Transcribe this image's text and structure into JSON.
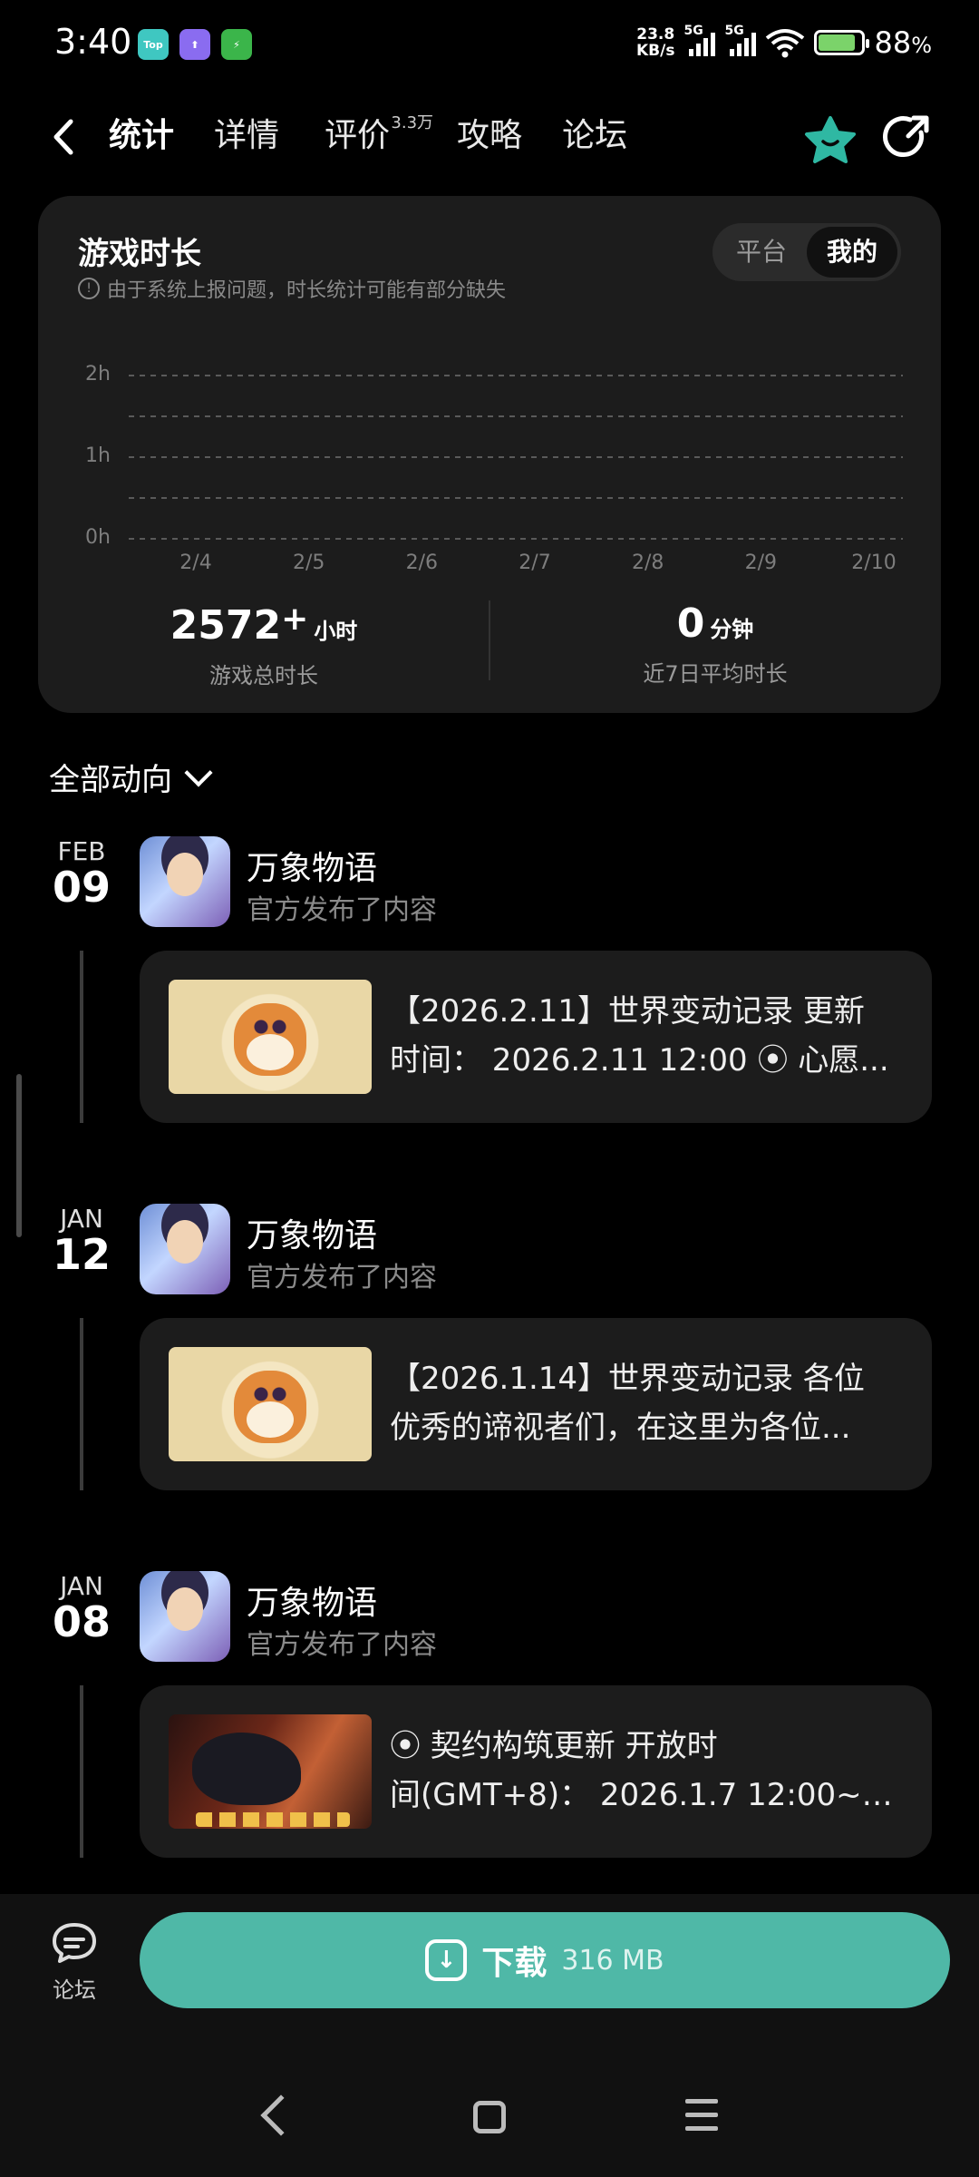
{
  "status_bar": {
    "time": "3:40",
    "apps": [
      {
        "name": "top-app-icon",
        "label": "Top",
        "color": "#3fc7c1"
      },
      {
        "name": "upload-app-icon",
        "label": "⬆",
        "color": "#8a6cf0"
      },
      {
        "name": "bolt-app-icon",
        "label": "⚡",
        "color": "#3bb54a"
      }
    ],
    "net_speed_value": "23.8",
    "net_speed_unit": "KB/s",
    "sig1_label": "5G",
    "sig2_label": "5G",
    "battery_pct": "88",
    "battery_unit": "%",
    "battery_level": 0.88
  },
  "nav": {
    "tabs": [
      {
        "label": "统计",
        "active": true
      },
      {
        "label": "详情"
      },
      {
        "label": "评价",
        "badge": "3.3万"
      },
      {
        "label": "攻略"
      },
      {
        "label": "论坛"
      }
    ],
    "icons": {
      "back": "back-arrow-icon",
      "star": "star-icon",
      "share": "share-icon"
    },
    "accent": "#2fb8a3"
  },
  "stats": {
    "title": "游戏时长",
    "note": "由于系统上报问题，时长统计可能有部分缺失",
    "toggle": {
      "left": "平台",
      "right": "我的",
      "selected": "我的"
    },
    "total": {
      "value": "2572",
      "suffix": "+",
      "unit": "小时",
      "label": "游戏总时长"
    },
    "average": {
      "value": "0",
      "unit": "分钟",
      "label": "近7日平均时长"
    }
  },
  "chart_data": {
    "type": "bar",
    "categories": [
      "2/4",
      "2/5",
      "2/6",
      "2/7",
      "2/8",
      "2/9",
      "2/10"
    ],
    "values": [
      0,
      0,
      0,
      0,
      0,
      0,
      0
    ],
    "y_ticks": [
      "2h",
      "1h",
      "0h"
    ],
    "ylim": [
      0,
      2
    ],
    "grid": true
  },
  "feed": {
    "filter_label": "全部动向",
    "posts": [
      {
        "month": "FEB",
        "day": "09",
        "author": "万象物语",
        "subtitle": "官方发布了内容",
        "line1": "【2026.2.11】世界变动记录 更新",
        "line2": "时间： 2026.2.11 12:00 ⦿ 心愿...",
        "thumb": "owl"
      },
      {
        "month": "JAN",
        "day": "12",
        "author": "万象物语",
        "subtitle": "官方发布了内容",
        "line1": "【2026.1.14】世界变动记录 各位",
        "line2": "优秀的谛视者们，在这里为各位...",
        "thumb": "owl"
      },
      {
        "month": "JAN",
        "day": "08",
        "author": "万象物语",
        "subtitle": "官方发布了内容",
        "line1": "⦿ 契约构筑更新  开放时",
        "line2": "间(GMT+8)： 2026.1.7 12:00~2...",
        "thumb": "dark"
      }
    ]
  },
  "bottom": {
    "forum_label": "论坛",
    "download_label": "下载",
    "download_size": "316 MB",
    "download_color": "#4fb8a7"
  }
}
